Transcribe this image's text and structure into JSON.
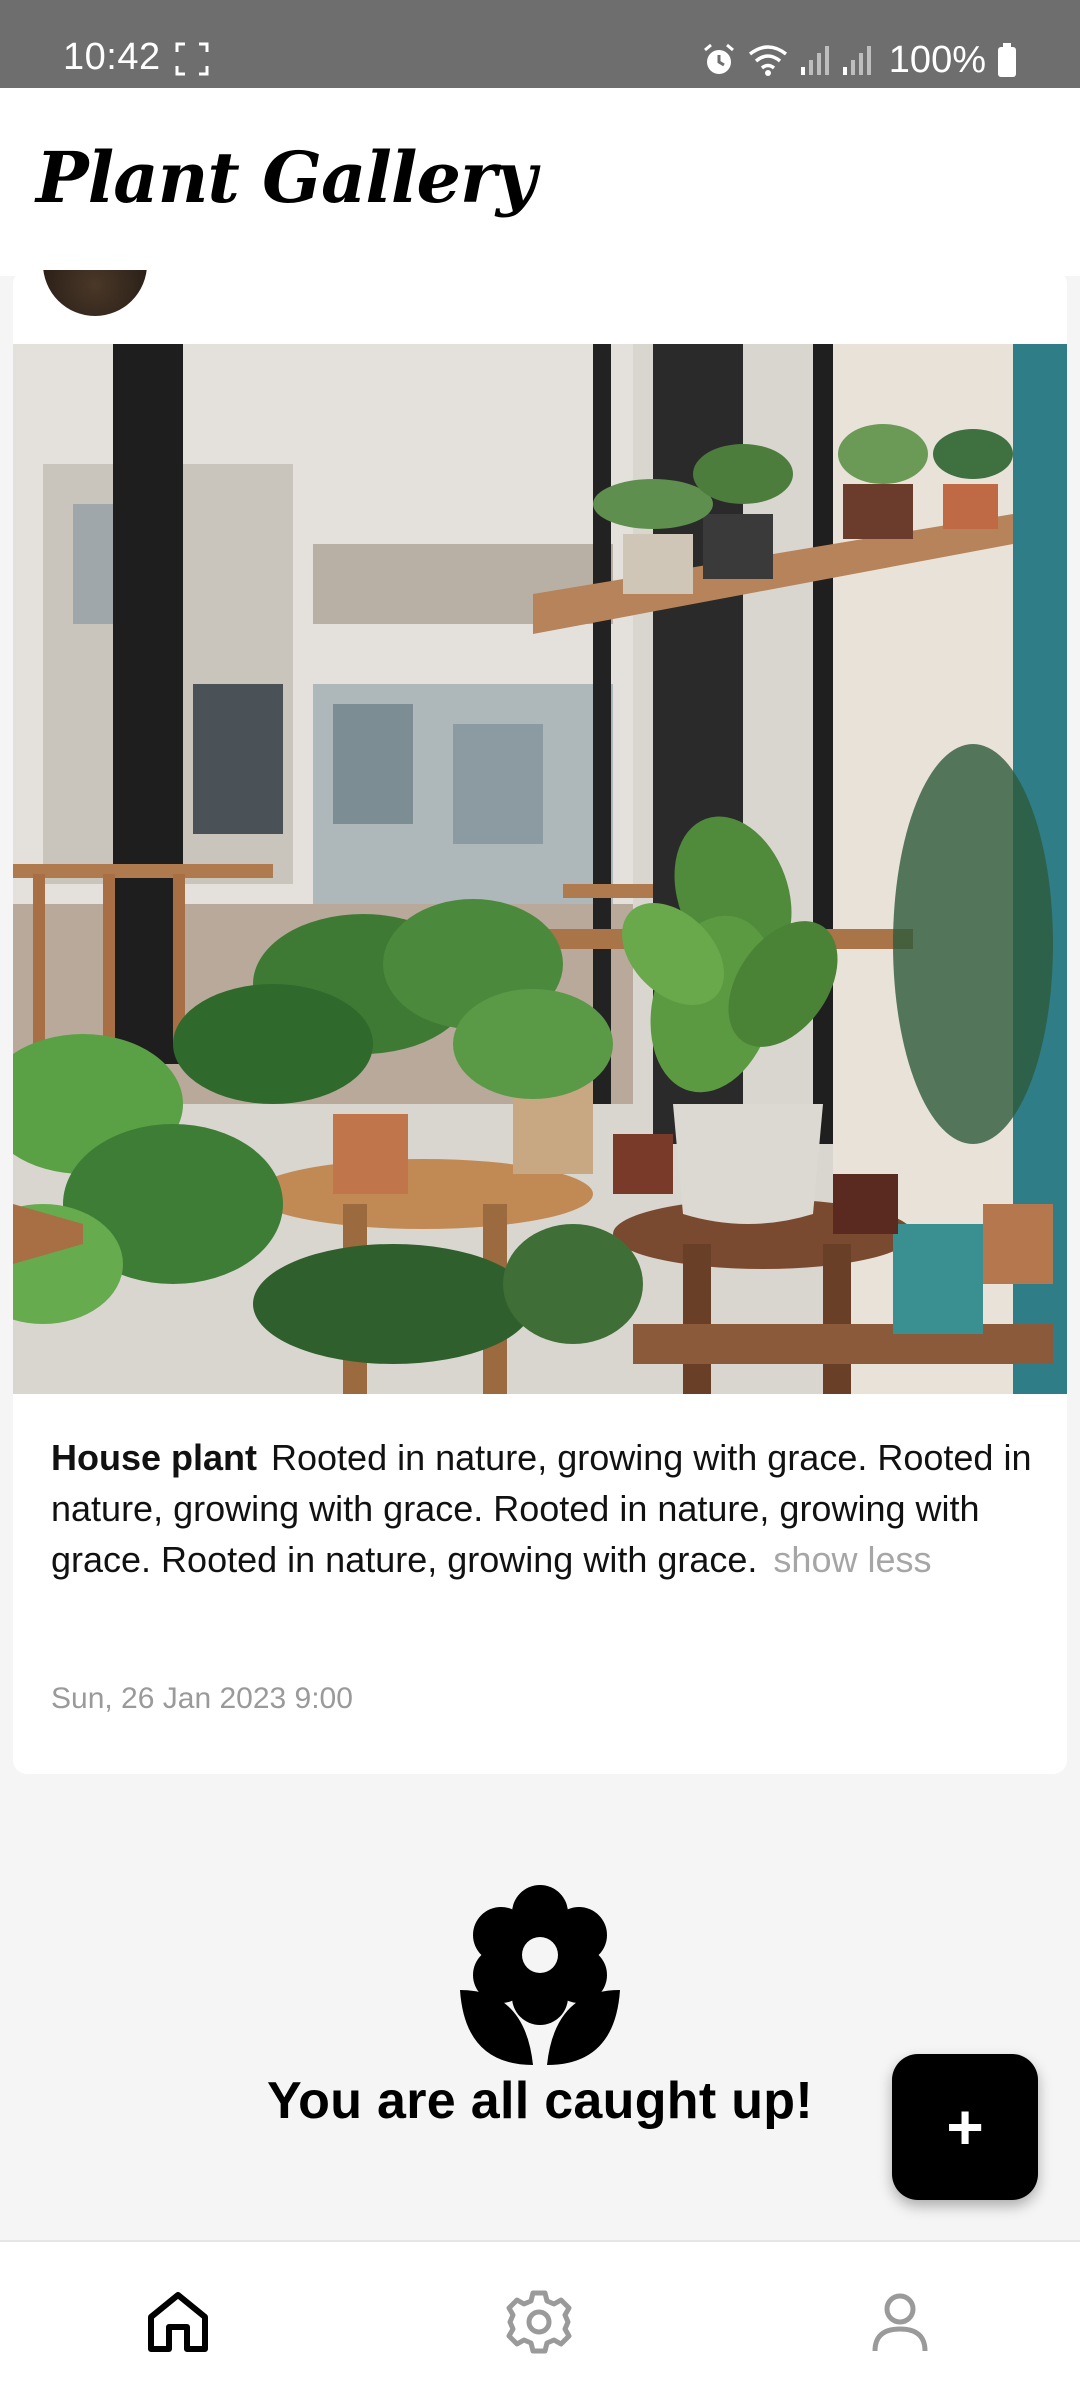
{
  "status_bar": {
    "time": "10:42",
    "battery": "100%",
    "icons": [
      "screenshot-icon",
      "alarm-icon",
      "wifi-icon",
      "signal-icon",
      "signal-icon",
      "battery-icon"
    ]
  },
  "header": {
    "title": "Plant Gallery"
  },
  "post": {
    "title": "House plant",
    "body": "Rooted in nature, growing with grace. Rooted in nature, growing with grace. Rooted in nature, growing with grace. Rooted in nature, growing with grace",
    "period": ".",
    "toggle_label": "show less",
    "timestamp": "Sun, 26 Jan 2023 9:00"
  },
  "feed_end": {
    "icon": "flower-icon",
    "message": "You are all caught up!"
  },
  "fab": {
    "icon": "plus-icon",
    "label": "+"
  },
  "bottom_nav": {
    "items": [
      {
        "icon": "home-icon",
        "active": true
      },
      {
        "icon": "settings-icon",
        "active": false
      },
      {
        "icon": "profile-icon",
        "active": false
      }
    ]
  },
  "colors": {
    "accent": "#000000",
    "muted_text": "#a6a6a6",
    "background": "#f5f5f5",
    "status_bar": "#6e6e6e"
  }
}
